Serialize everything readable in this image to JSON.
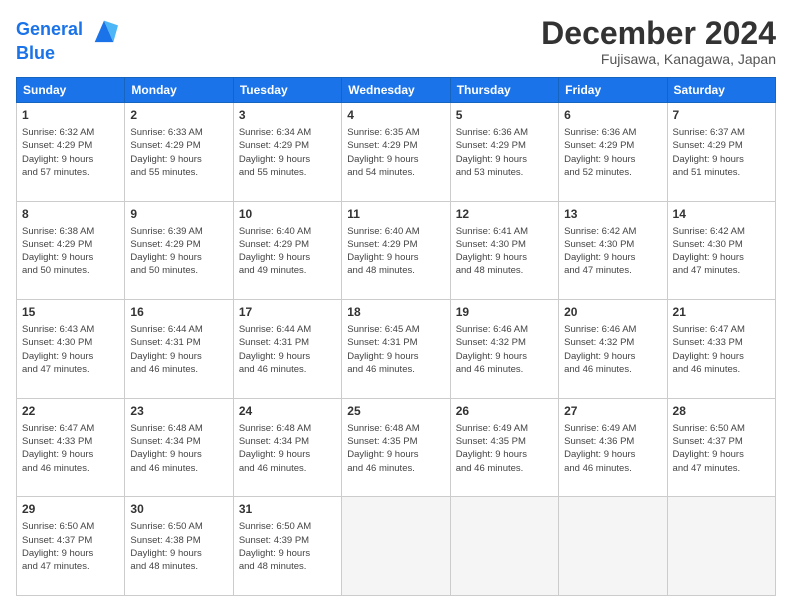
{
  "header": {
    "logo_line1": "General",
    "logo_line2": "Blue",
    "month": "December 2024",
    "location": "Fujisawa, Kanagawa, Japan"
  },
  "weekdays": [
    "Sunday",
    "Monday",
    "Tuesday",
    "Wednesday",
    "Thursday",
    "Friday",
    "Saturday"
  ],
  "weeks": [
    [
      {
        "day": 1,
        "info": "Sunrise: 6:32 AM\nSunset: 4:29 PM\nDaylight: 9 hours\nand 57 minutes."
      },
      {
        "day": 2,
        "info": "Sunrise: 6:33 AM\nSunset: 4:29 PM\nDaylight: 9 hours\nand 55 minutes."
      },
      {
        "day": 3,
        "info": "Sunrise: 6:34 AM\nSunset: 4:29 PM\nDaylight: 9 hours\nand 55 minutes."
      },
      {
        "day": 4,
        "info": "Sunrise: 6:35 AM\nSunset: 4:29 PM\nDaylight: 9 hours\nand 54 minutes."
      },
      {
        "day": 5,
        "info": "Sunrise: 6:36 AM\nSunset: 4:29 PM\nDaylight: 9 hours\nand 53 minutes."
      },
      {
        "day": 6,
        "info": "Sunrise: 6:36 AM\nSunset: 4:29 PM\nDaylight: 9 hours\nand 52 minutes."
      },
      {
        "day": 7,
        "info": "Sunrise: 6:37 AM\nSunset: 4:29 PM\nDaylight: 9 hours\nand 51 minutes."
      }
    ],
    [
      {
        "day": 8,
        "info": "Sunrise: 6:38 AM\nSunset: 4:29 PM\nDaylight: 9 hours\nand 50 minutes."
      },
      {
        "day": 9,
        "info": "Sunrise: 6:39 AM\nSunset: 4:29 PM\nDaylight: 9 hours\nand 50 minutes."
      },
      {
        "day": 10,
        "info": "Sunrise: 6:40 AM\nSunset: 4:29 PM\nDaylight: 9 hours\nand 49 minutes."
      },
      {
        "day": 11,
        "info": "Sunrise: 6:40 AM\nSunset: 4:29 PM\nDaylight: 9 hours\nand 48 minutes."
      },
      {
        "day": 12,
        "info": "Sunrise: 6:41 AM\nSunset: 4:30 PM\nDaylight: 9 hours\nand 48 minutes."
      },
      {
        "day": 13,
        "info": "Sunrise: 6:42 AM\nSunset: 4:30 PM\nDaylight: 9 hours\nand 47 minutes."
      },
      {
        "day": 14,
        "info": "Sunrise: 6:42 AM\nSunset: 4:30 PM\nDaylight: 9 hours\nand 47 minutes."
      }
    ],
    [
      {
        "day": 15,
        "info": "Sunrise: 6:43 AM\nSunset: 4:30 PM\nDaylight: 9 hours\nand 47 minutes."
      },
      {
        "day": 16,
        "info": "Sunrise: 6:44 AM\nSunset: 4:31 PM\nDaylight: 9 hours\nand 46 minutes."
      },
      {
        "day": 17,
        "info": "Sunrise: 6:44 AM\nSunset: 4:31 PM\nDaylight: 9 hours\nand 46 minutes."
      },
      {
        "day": 18,
        "info": "Sunrise: 6:45 AM\nSunset: 4:31 PM\nDaylight: 9 hours\nand 46 minutes."
      },
      {
        "day": 19,
        "info": "Sunrise: 6:46 AM\nSunset: 4:32 PM\nDaylight: 9 hours\nand 46 minutes."
      },
      {
        "day": 20,
        "info": "Sunrise: 6:46 AM\nSunset: 4:32 PM\nDaylight: 9 hours\nand 46 minutes."
      },
      {
        "day": 21,
        "info": "Sunrise: 6:47 AM\nSunset: 4:33 PM\nDaylight: 9 hours\nand 46 minutes."
      }
    ],
    [
      {
        "day": 22,
        "info": "Sunrise: 6:47 AM\nSunset: 4:33 PM\nDaylight: 9 hours\nand 46 minutes."
      },
      {
        "day": 23,
        "info": "Sunrise: 6:48 AM\nSunset: 4:34 PM\nDaylight: 9 hours\nand 46 minutes."
      },
      {
        "day": 24,
        "info": "Sunrise: 6:48 AM\nSunset: 4:34 PM\nDaylight: 9 hours\nand 46 minutes."
      },
      {
        "day": 25,
        "info": "Sunrise: 6:48 AM\nSunset: 4:35 PM\nDaylight: 9 hours\nand 46 minutes."
      },
      {
        "day": 26,
        "info": "Sunrise: 6:49 AM\nSunset: 4:35 PM\nDaylight: 9 hours\nand 46 minutes."
      },
      {
        "day": 27,
        "info": "Sunrise: 6:49 AM\nSunset: 4:36 PM\nDaylight: 9 hours\nand 46 minutes."
      },
      {
        "day": 28,
        "info": "Sunrise: 6:50 AM\nSunset: 4:37 PM\nDaylight: 9 hours\nand 47 minutes."
      }
    ],
    [
      {
        "day": 29,
        "info": "Sunrise: 6:50 AM\nSunset: 4:37 PM\nDaylight: 9 hours\nand 47 minutes."
      },
      {
        "day": 30,
        "info": "Sunrise: 6:50 AM\nSunset: 4:38 PM\nDaylight: 9 hours\nand 48 minutes."
      },
      {
        "day": 31,
        "info": "Sunrise: 6:50 AM\nSunset: 4:39 PM\nDaylight: 9 hours\nand 48 minutes."
      },
      {
        "day": null,
        "info": ""
      },
      {
        "day": null,
        "info": ""
      },
      {
        "day": null,
        "info": ""
      },
      {
        "day": null,
        "info": ""
      }
    ]
  ]
}
